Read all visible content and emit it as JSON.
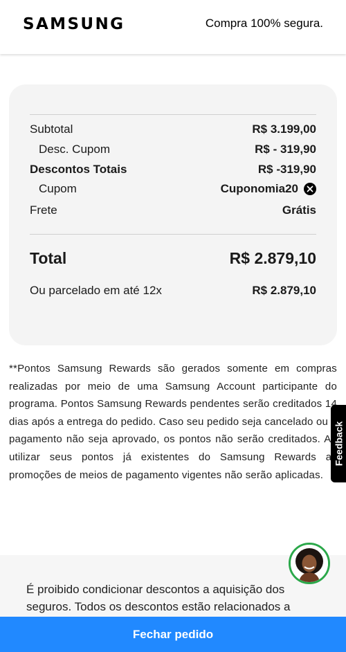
{
  "header": {
    "logo": "SAMSUNG",
    "secure_text": "Compra 100% segura."
  },
  "summary": {
    "subtotal_label": "Subtotal",
    "subtotal_value": "R$ 3.199,00",
    "desc_cupom_label": "Desc. Cupom",
    "desc_cupom_value": "R$ - 319,90",
    "descontos_totais_label": "Descontos Totais",
    "descontos_totais_value": "R$ -319,90",
    "cupom_label": "Cupom",
    "cupom_code": "Cuponomia20",
    "frete_label": "Frete",
    "frete_value": "Grátis",
    "total_label": "Total",
    "total_value": "R$ 2.879,10",
    "parcelado_label": "Ou parcelado em até 12x",
    "parcelado_value": "R$ 2.879,10"
  },
  "disclaimer": "**Pontos Samsung Rewards são gerados somente em compras realizadas por meio de uma Samsung Account participante do programa. Pontos Samsung Rewards pendentes serão creditados 14 dias após a entrega do pedido. Caso seu pedido seja cancelado ou o pagamento não seja aprovado, os pontos não serão creditados. Ao utilizar seus pontos já existentes do Samsung Rewards as promoções de meios de pagamento vigentes não serão aplicadas.",
  "feedback_label": "Feedback",
  "insurance_text": "É proibido condicionar descontos a aquisição dos seguros. Todos os descontos estão relacionados a",
  "cta_label": "Fechar pedido",
  "icons": {
    "remove_coupon": "close-circle-icon",
    "chat": "chat-agent-avatar"
  },
  "colors": {
    "cta": "#2189ff",
    "avatar_ring": "#2ba84a"
  }
}
